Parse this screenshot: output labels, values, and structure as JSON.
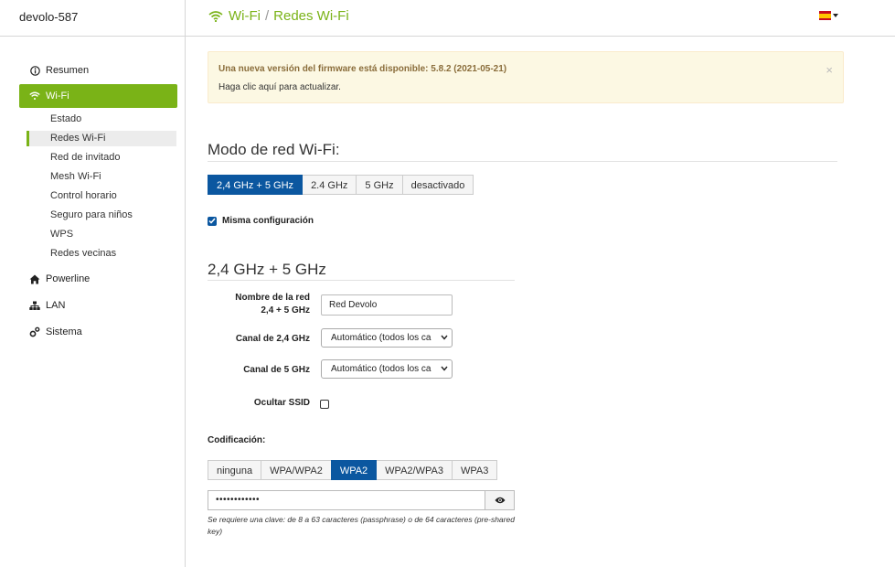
{
  "header": {
    "device_name": "devolo-587",
    "breadcrumb": {
      "parent": "Wi-Fi",
      "separator": "/",
      "current": "Redes Wi-Fi"
    }
  },
  "language": {
    "icon": "spain-flag-icon"
  },
  "sidebar": {
    "items": [
      {
        "label": "Resumen",
        "icon": "info-icon"
      },
      {
        "label": "Wi-Fi",
        "icon": "wifi-icon",
        "active": true,
        "children": [
          "Estado",
          "Redes Wi-Fi",
          "Red de invitado",
          "Mesh Wi-Fi",
          "Control horario",
          "Seguro para niños",
          "WPS",
          "Redes vecinas"
        ],
        "active_child": "Redes Wi-Fi"
      },
      {
        "label": "Powerline",
        "icon": "home-icon"
      },
      {
        "label": "LAN",
        "icon": "network-icon"
      },
      {
        "label": "Sistema",
        "icon": "gears-icon"
      }
    ]
  },
  "alert": {
    "title": "Una nueva versión del firmware está disponible: 5.8.2 (2021-05-21)",
    "link": "Haga clic aquí para actualizar.",
    "close": "×"
  },
  "mode": {
    "title": "Modo de red Wi-Fi:",
    "options": [
      "2,4 GHz + 5 GHz",
      "2.4 GHz",
      "5 GHz",
      "desactivado"
    ],
    "selected": "2,4 GHz + 5 GHz",
    "same_config_label": "Misma configuración",
    "same_config_checked": true
  },
  "band": {
    "title": "2,4 GHz + 5 GHz",
    "ssid_label_line1": "Nombre de la red",
    "ssid_label_line2": "2,4 + 5 GHz",
    "ssid_value": "Red Devolo",
    "channel24_label": "Canal de 2,4 GHz",
    "channel24_value": "Automático (todos los ca",
    "channel5_label": "Canal de 5 GHz",
    "channel5_value": "Automático (todos los ca",
    "hide_ssid_label": "Ocultar SSID",
    "hide_ssid_checked": false
  },
  "encryption": {
    "label": "Codificación:",
    "options": [
      "ninguna",
      "WPA/WPA2",
      "WPA2",
      "WPA2/WPA3",
      "WPA3"
    ],
    "selected": "WPA2",
    "password_mask": "••••••••••••",
    "help": "Se requiere una clave: de 8 a 63 caracteres (passphrase) o de 64 caracteres (pre-shared key)"
  },
  "colors": {
    "accent": "#7ab317",
    "selected": "#0b57a0",
    "alert_bg": "#fcf8e3"
  }
}
